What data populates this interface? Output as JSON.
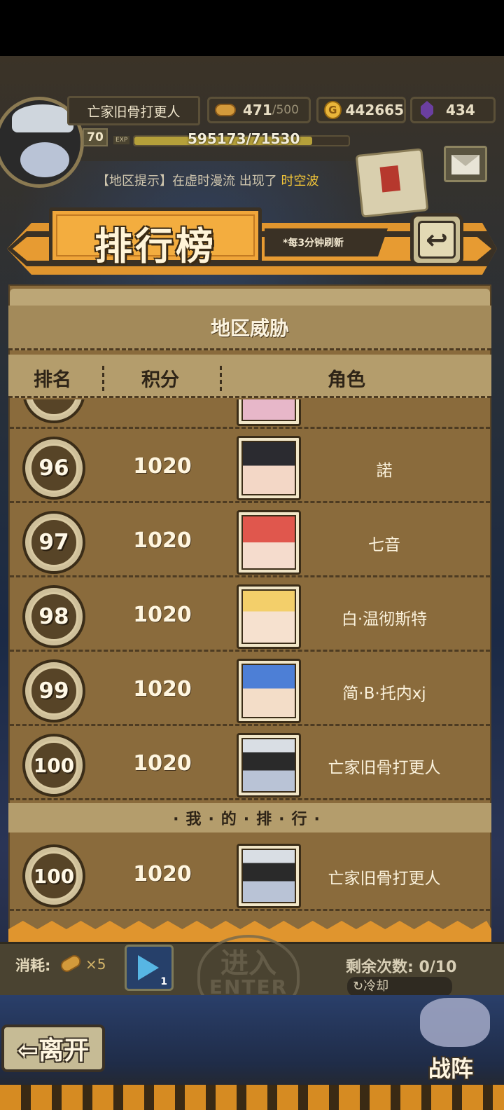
{
  "player": {
    "name": "亡家旧骨打更人",
    "level": "70",
    "exp_label": "EXP",
    "exp_text": "595173/71530",
    "exp_fraction": 0.83
  },
  "resources": {
    "stamina_current": "471",
    "stamina_max": "/500",
    "gold": "442665",
    "gold_symbol": "G",
    "gems": "434"
  },
  "notice": {
    "prefix": "【地区提示】在虚时漫流 出现了 ",
    "highlight": "时空波"
  },
  "banner": {
    "title": "排行榜",
    "refresh_note": "*每3分钟刷新",
    "back_glyph": "↩"
  },
  "panel": {
    "header": "地区威胁",
    "columns": {
      "rank": "排名",
      "score": "积分",
      "character": "角色"
    },
    "rows": [
      {
        "rank": "96",
        "score": "1020",
        "name": "諾"
      },
      {
        "rank": "97",
        "score": "1020",
        "name": "七音"
      },
      {
        "rank": "98",
        "score": "1020",
        "name": "白·温彻斯特"
      },
      {
        "rank": "99",
        "score": "1020",
        "name": "简·B·托内xj"
      },
      {
        "rank": "100",
        "score": "1020",
        "name": "亡家旧骨打更人"
      }
    ],
    "my_rank_label": "·我·的·排·行·",
    "my_rank": {
      "rank": "100",
      "score": "1020",
      "name": "亡家旧骨打更人"
    }
  },
  "bottom": {
    "cost_label": "消耗:",
    "cost_count": "×5",
    "ticket_count": "1",
    "enter_cn": "进入",
    "enter_en": "ENTER",
    "remaining": "剩余次数: 0/10",
    "cooldown": "↻冷却",
    "leave": "⇦离开",
    "team": "战阵"
  },
  "colors": {
    "accent_orange": "#e0952e",
    "panel_brown": "#8a6b3c",
    "highlight_yellow": "#f2c538"
  }
}
